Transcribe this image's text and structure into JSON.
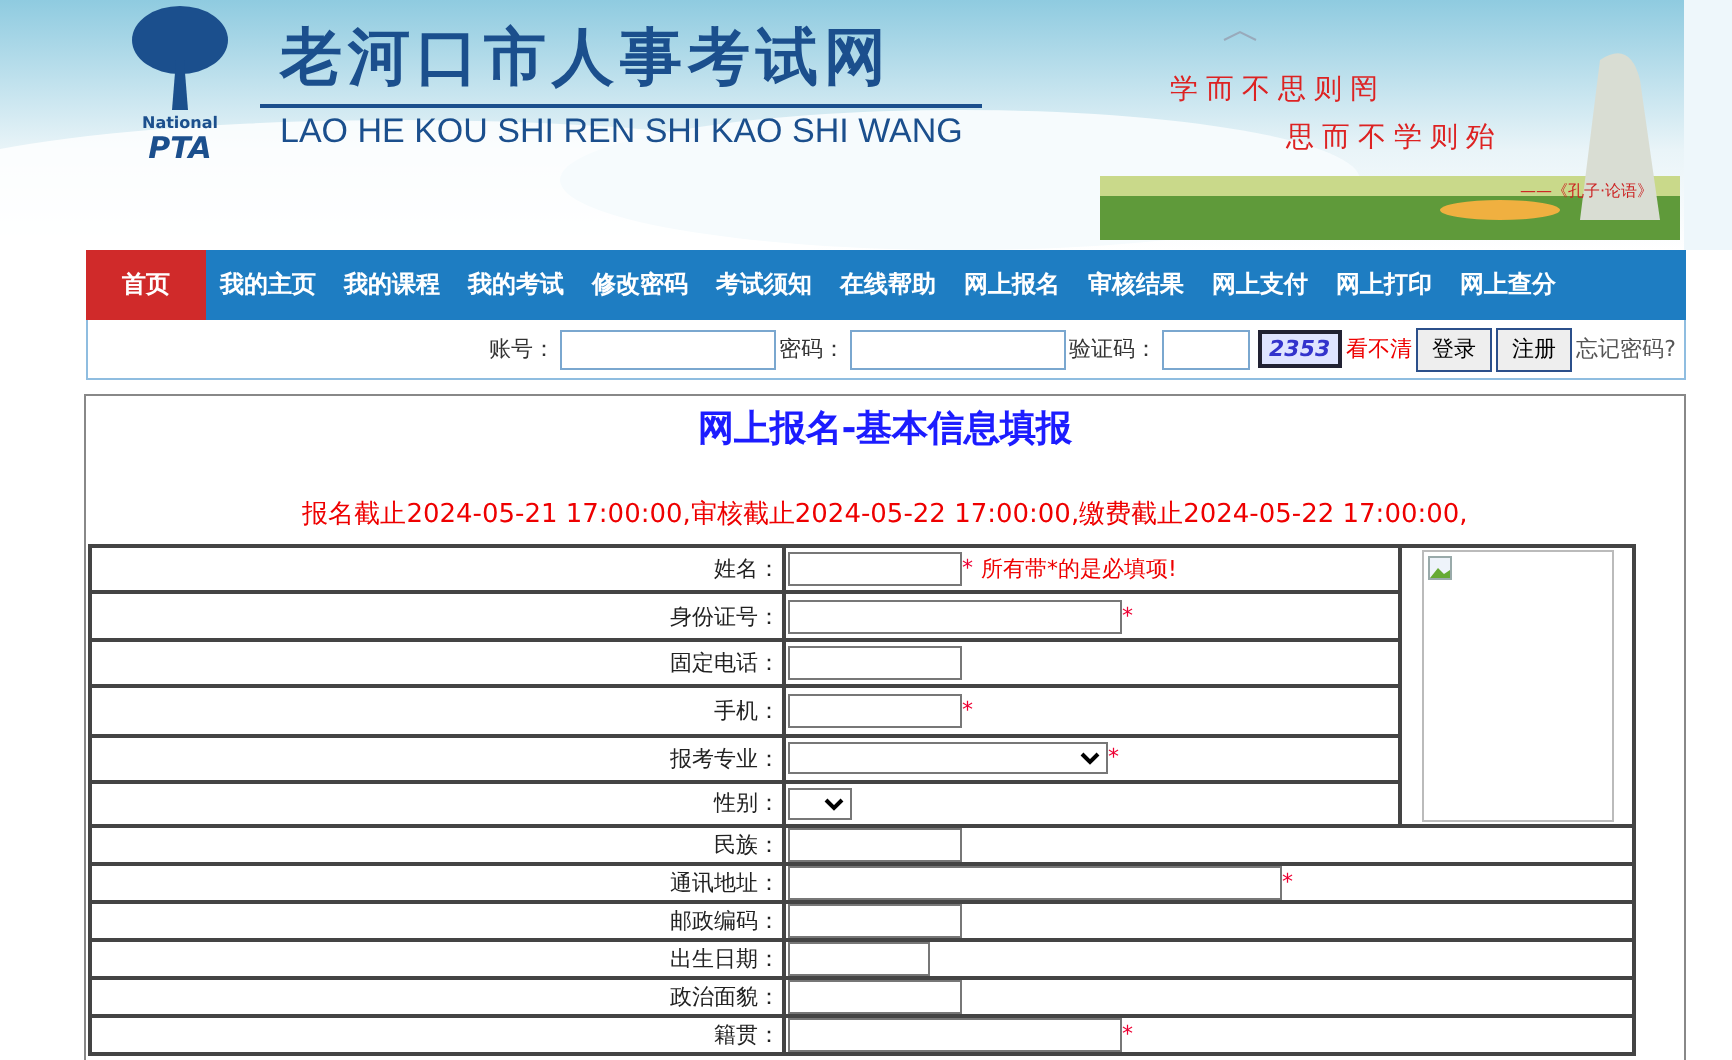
{
  "header": {
    "logo_top": "National",
    "logo_bottom": "PTA",
    "title": "老河口市人事考试网",
    "subtitle": "LAO HE KOU SHI REN SHI KAO SHI WANG",
    "quote_lines": [
      "学而不思则罔",
      "思而不学则殆"
    ],
    "quote_source": "——《孔子·论语》"
  },
  "nav": [
    {
      "label": "首页",
      "selected": true
    },
    {
      "label": "我的主页",
      "selected": false
    },
    {
      "label": "我的课程",
      "selected": false
    },
    {
      "label": "我的考试",
      "selected": false
    },
    {
      "label": "修改密码",
      "selected": false
    },
    {
      "label": "考试须知",
      "selected": false
    },
    {
      "label": "在线帮助",
      "selected": false
    },
    {
      "label": "网上报名",
      "selected": false
    },
    {
      "label": "审核结果",
      "selected": false
    },
    {
      "label": "网上支付",
      "selected": false
    },
    {
      "label": "网上打印",
      "selected": false
    },
    {
      "label": "网上查分",
      "selected": false
    }
  ],
  "login": {
    "account_label": "账号：",
    "password_label": "密码：",
    "captcha_label": "验证码：",
    "captcha": "2353",
    "refresh": "看不清",
    "buttons": [
      "登录",
      "注册"
    ],
    "forgot": "忘记密码?"
  },
  "form": {
    "title": "网上报名-基本信息填报",
    "deadlines": "报名截止2024-05-21 17:00:00,审核截止2024-05-22 17:00:00,缴费截止2024-05-22 17:00:00,",
    "rows": [
      {
        "label": "姓名：",
        "kind": "text",
        "mark": "*",
        "note": "所有带*的是必填项!"
      },
      {
        "label": "身份证号：",
        "kind": "text",
        "mark": "*"
      },
      {
        "label": "固定电话：",
        "kind": "text"
      },
      {
        "label": "手机：",
        "kind": "text",
        "mark": "*"
      },
      {
        "label": "报考专业：",
        "kind": "select",
        "mark": "*"
      },
      {
        "label": "性别：",
        "kind": "select"
      },
      {
        "label": "民族：",
        "kind": "text"
      },
      {
        "label": "通讯地址：",
        "kind": "text",
        "mark": "*"
      },
      {
        "label": "邮政编码：",
        "kind": "text"
      },
      {
        "label": "出生日期：",
        "kind": "text"
      },
      {
        "label": "政治面貌：",
        "kind": "text"
      },
      {
        "label": "籍贯：",
        "kind": "text",
        "mark": "*"
      }
    ]
  }
}
